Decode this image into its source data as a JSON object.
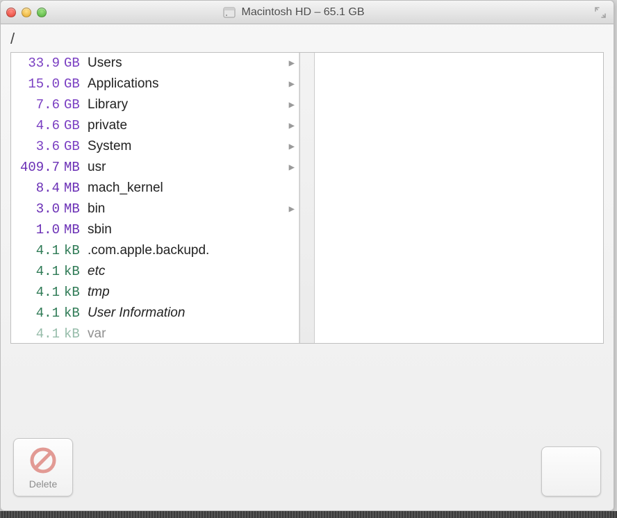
{
  "titlebar": {
    "title": "Macintosh HD – 65.1 GB"
  },
  "path": "/",
  "items": [
    {
      "size": "33.9",
      "unit": "GB",
      "uclass": "gb",
      "name": "Users",
      "italic": false,
      "hasChildren": true
    },
    {
      "size": "15.0",
      "unit": "GB",
      "uclass": "gb",
      "name": "Applications",
      "italic": false,
      "hasChildren": true
    },
    {
      "size": "7.6",
      "unit": "GB",
      "uclass": "gb",
      "name": "Library",
      "italic": false,
      "hasChildren": true
    },
    {
      "size": "4.6",
      "unit": "GB",
      "uclass": "gb",
      "name": "private",
      "italic": false,
      "hasChildren": true
    },
    {
      "size": "3.6",
      "unit": "GB",
      "uclass": "gb",
      "name": "System",
      "italic": false,
      "hasChildren": true
    },
    {
      "size": "409.7",
      "unit": "MB",
      "uclass": "mb",
      "name": "usr",
      "italic": false,
      "hasChildren": true
    },
    {
      "size": "8.4",
      "unit": "MB",
      "uclass": "mb",
      "name": "mach_kernel",
      "italic": false,
      "hasChildren": false
    },
    {
      "size": "3.0",
      "unit": "MB",
      "uclass": "mb",
      "name": "bin",
      "italic": false,
      "hasChildren": true
    },
    {
      "size": "1.0",
      "unit": "MB",
      "uclass": "mb",
      "name": "sbin",
      "italic": false,
      "hasChildren": false
    },
    {
      "size": "4.1",
      "unit": "kB",
      "uclass": "kb",
      "name": ".com.apple.backupd.",
      "italic": false,
      "hasChildren": false
    },
    {
      "size": "4.1",
      "unit": "kB",
      "uclass": "kb",
      "name": "etc",
      "italic": true,
      "hasChildren": false
    },
    {
      "size": "4.1",
      "unit": "kB",
      "uclass": "kb",
      "name": "tmp",
      "italic": true,
      "hasChildren": false
    },
    {
      "size": "4.1",
      "unit": "kB",
      "uclass": "kb",
      "name": "User Information",
      "italic": true,
      "hasChildren": false
    },
    {
      "size": "4.1",
      "unit": "kB",
      "uclass": "kb",
      "name": "var",
      "italic": false,
      "hasChildren": false,
      "cut": true
    }
  ],
  "toolbar": {
    "delete_label": "Delete"
  }
}
